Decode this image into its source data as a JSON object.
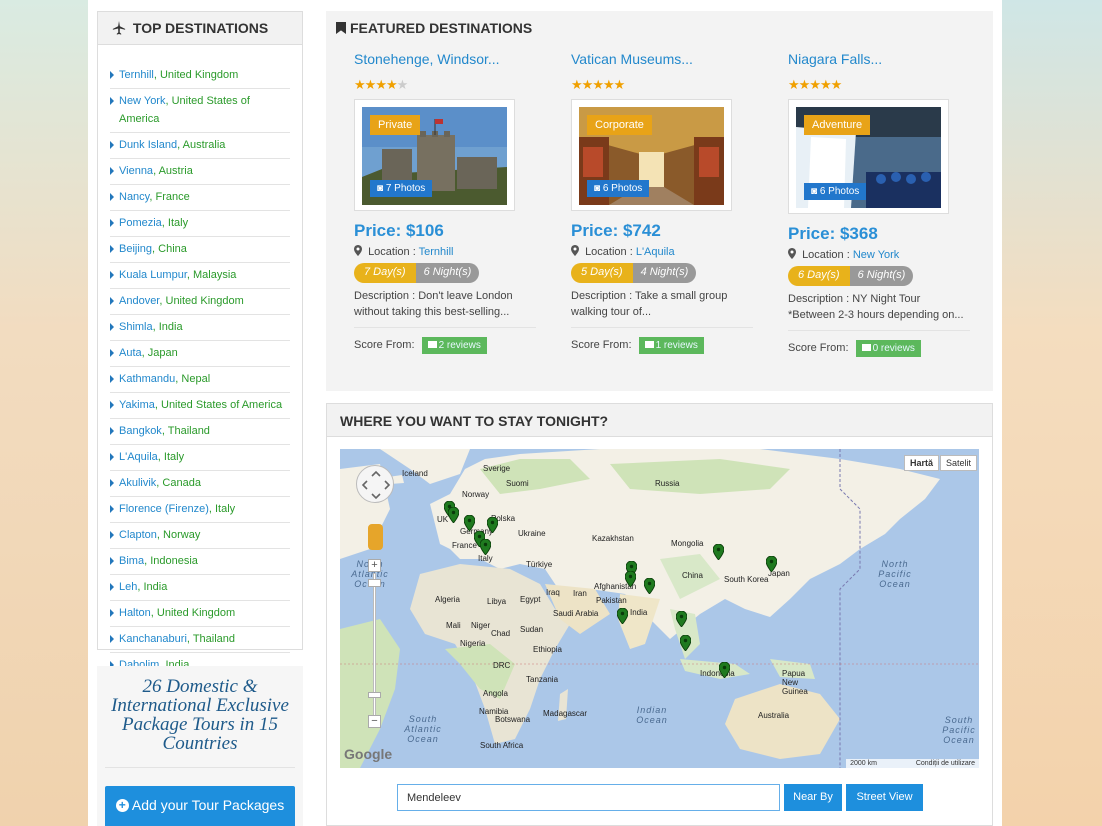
{
  "top_destinations": {
    "title": "TOP DESTINATIONS",
    "items": [
      {
        "city": "Ternhill",
        "country": "United Kingdom"
      },
      {
        "city": "New York",
        "country": "United States of America"
      },
      {
        "city": "Dunk Island",
        "country": "Australia"
      },
      {
        "city": "Vienna",
        "country": "Austria"
      },
      {
        "city": "Nancy",
        "country": "France"
      },
      {
        "city": "Pomezia",
        "country": "Italy"
      },
      {
        "city": "Beijing",
        "country": "China"
      },
      {
        "city": "Kuala Lumpur",
        "country": "Malaysia"
      },
      {
        "city": "Andover",
        "country": "United Kingdom"
      },
      {
        "city": "Shimla",
        "country": "India"
      },
      {
        "city": "Auta",
        "country": "Japan"
      },
      {
        "city": "Kathmandu",
        "country": "Nepal"
      },
      {
        "city": "Yakima",
        "country": "United States of America"
      },
      {
        "city": "Bangkok",
        "country": "Thailand"
      },
      {
        "city": "L'Aquila",
        "country": "Italy"
      },
      {
        "city": "Akulivik",
        "country": "Canada"
      },
      {
        "city": "Florence (Firenze)",
        "country": "Italy"
      },
      {
        "city": "Clapton",
        "country": "Norway"
      },
      {
        "city": "Bima",
        "country": "Indonesia"
      },
      {
        "city": "Leh",
        "country": "India"
      },
      {
        "city": "Halton",
        "country": "United Kingdom"
      },
      {
        "city": "Kanchanaburi",
        "country": "Thailand"
      },
      {
        "city": "Dabolim",
        "country": "India"
      }
    ]
  },
  "promo": {
    "text": "26 Domestic & International Exclusive Package Tours in 15 Countries",
    "button_label": "Add your Tour Packages"
  },
  "featured": {
    "title": "FEATURED DESTINATIONS",
    "cards": [
      {
        "title": "Stonehenge, Windsor...",
        "rating": 4,
        "tag": "Private",
        "photos": "7 Photos",
        "price": "Price: $106",
        "location_label": "Location :",
        "location": "Ternhill",
        "days": "7 Day(s)",
        "nights": "6 Night(s)",
        "description": "Description : Don't leave London without taking this best-selling...",
        "score_label": "Score From:",
        "reviews": "2 reviews"
      },
      {
        "title": "Vatican Museums...",
        "rating": 5,
        "tag": "Corporate",
        "photos": "6 Photos",
        "price": "Price: $742",
        "location_label": "Location :",
        "location": "L'Aquila",
        "days": "5 Day(s)",
        "nights": "4 Night(s)",
        "description": "Description : Take a small group walking tour of...",
        "score_label": "Score From:",
        "reviews": "1 reviews"
      },
      {
        "title": "Niagara Falls...",
        "rating": 5,
        "tag": "Adventure",
        "photos": "6 Photos",
        "price": "Price: $368",
        "location_label": "Location :",
        "location": "New York",
        "days": "6 Day(s)",
        "nights": "6 Night(s)",
        "description": "Description : NY Night Tour *Between 2-3 hours depending on...",
        "score_label": "Score From:",
        "reviews": "0 reviews"
      }
    ]
  },
  "stay": {
    "title": "WHERE YOU WANT TO STAY TONIGHT?",
    "map_type_map": "Hartă",
    "map_type_satellite": "Satelit",
    "google": "Google",
    "scale": "2000 km",
    "terms": "Condiții de utilizare",
    "labels": {
      "north_atlantic": "North Atlantic Ocean",
      "north_pacific": "North Pacific Ocean",
      "south_atlantic": "South Atlantic Ocean",
      "indian": "Indian Ocean",
      "south_pacific": "South Pacific Ocean",
      "algeria": "Algeria",
      "libya": "Libya",
      "egypt": "Egypt",
      "mali": "Mali",
      "niger": "Niger",
      "chad": "Chad",
      "sudan": "Sudan",
      "nigeria": "Nigeria",
      "ethiopia": "Ethiopia",
      "drc": "DRC",
      "tanzania": "Tanzania",
      "angola": "Angola",
      "namibia": "Namibia",
      "botswana": "Botswana",
      "madagascar": "Madagascar",
      "south_africa": "South Africa",
      "iraq": "Iraq",
      "iran": "Iran",
      "saudi": "Saudi Arabia",
      "afghanistan": "Afghanistan",
      "pakistan": "Pakistan",
      "india": "India",
      "china": "China",
      "mongolia": "Mongolia",
      "kazakhstan": "Kazakhstan",
      "turkey": "Türkiye",
      "russia": "Russia",
      "norway": "Norway",
      "sweden": "Sverige",
      "finland": "Suomi",
      "uk": "UK",
      "france": "France",
      "germany": "Germany",
      "italy": "Italy",
      "poland": "Polska",
      "ukraine": "Ukraine",
      "japan": "Japan",
      "south_korea": "South Korea",
      "indonesia": "Indonesia",
      "australia": "Australia",
      "papua": "Papua New Guinea",
      "iceland": "Iceland"
    },
    "search_value": "Mendeleev",
    "near_by": "Near By",
    "street_view": "Street View"
  }
}
